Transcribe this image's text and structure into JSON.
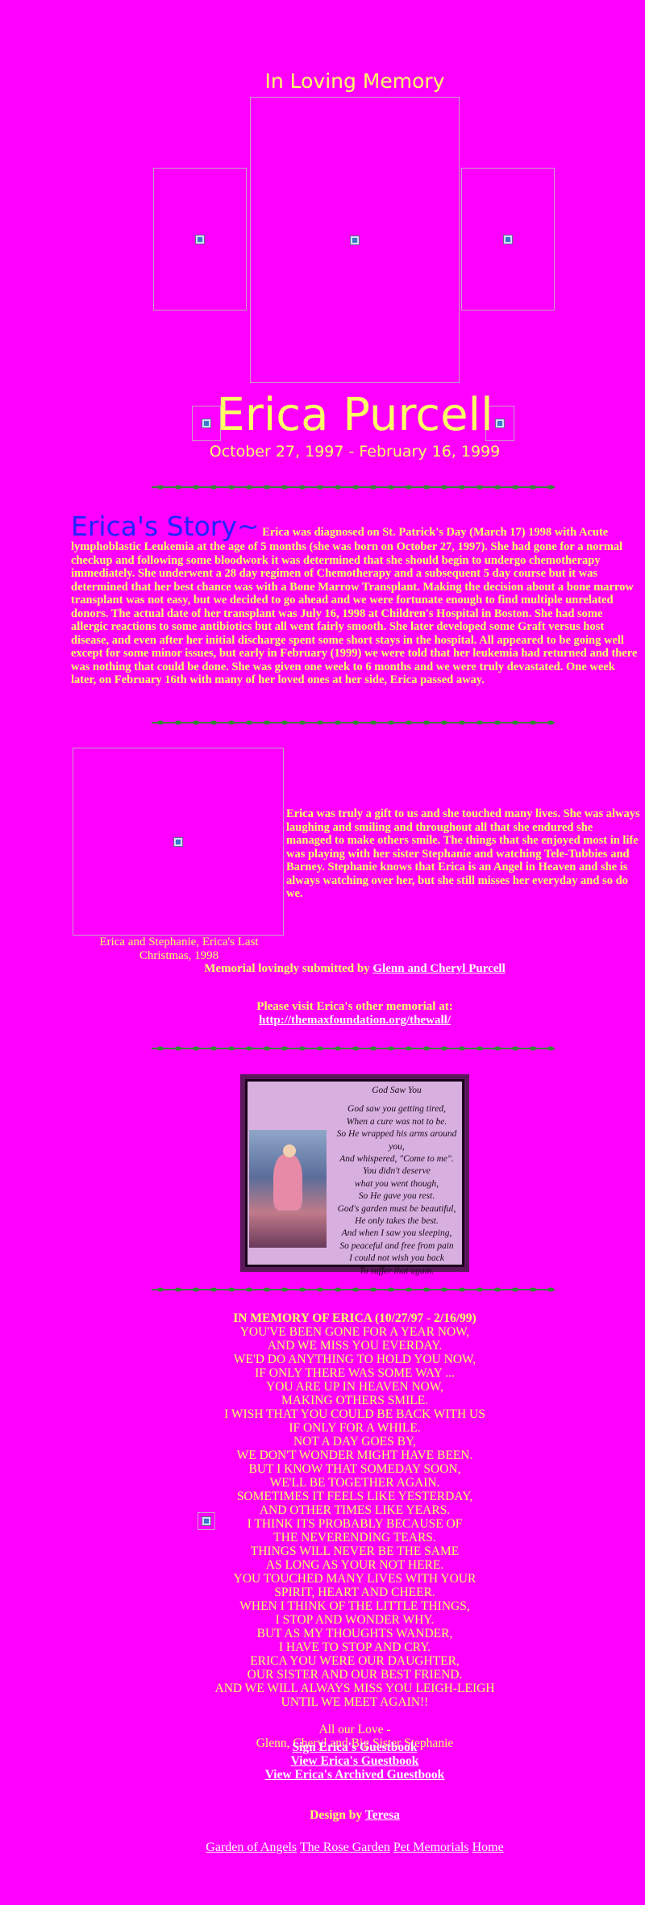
{
  "header": {
    "title": "In Loving Memory",
    "name": "Erica Purcell",
    "dates": "October 27, 1997 - February 16, 1999"
  },
  "story": {
    "heading": "Erica's Story~",
    "text": "Erica was diagnosed on St. Patrick's Day (March 17) 1998 with Acute lymphoblastic Leukemia at the age of 5 months (she was born on October 27, 1997). She had gone for a normal checkup and following some bloodwork it was determined that she should begin to undergo chemotherapy immediately. She underwent a 28 day regimen of Chemotherapy and a subsequent 5 day course but it was determined that her best chance was with a Bone Marrow Transplant. Making the decision about a bone marrow transplant was not easy, but we decided to go ahead and we were fortunate enough to find multiple unrelated donors. The actual date of her transplant was July 16, 1998 at Children's Hospital in Boston. She had some allergic reactions to some antibiotics but all went fairly smooth. She later developed some Graft versus host disease, and even after her initial discharge spent some short stays in the hospital. All appeared to be going well except for some minor issues, but early in February (1999) we were told that her leukemia had returned and there was nothing that could be done. She was given one week to 6 months and we were truly devastated. One week later, on February 16th with many of her loved ones at her side, Erica passed away."
  },
  "gift": {
    "text": "Erica was truly a gift to us and she touched many lives. She was always laughing and smiling and throughout all that she endured she managed to make others smile. The things that she enjoyed most in life was playing with her sister Stephanie and watching Tele-Tubbies and Barney. Stephanie knows that Erica is an Angel in Heaven and she is always watching over her, but she still misses her everyday and so do we.",
    "caption": "Erica and Stephanie, Erica's Last Christmas, 1998"
  },
  "submitted": {
    "prefix": "Memorial lovingly submitted by",
    "link": "Glenn and Cheryl Purcell "
  },
  "other": {
    "prefix": "Please visit Erica's other memorial at:",
    "link": "http://themaxfoundation.org/thewall/"
  },
  "poem": {
    "title": "God Saw You",
    "lines": [
      "God saw you getting tired,",
      "When a cure was not to be.",
      "So He wrapped his arms around you,",
      "And whispered, \"Come to me\".",
      "You didn't deserve",
      "what you went though,",
      "So He gave you rest.",
      "God's garden must be beautiful,",
      "He only takes the best.",
      "And when I saw you sleeping,",
      "So peaceful and free from pain",
      "I could not wish you back",
      "To suffer that again."
    ]
  },
  "tribute": {
    "heading": "IN MEMORY OF ERICA (10/27/97 - 2/16/99)",
    "lines": [
      "YOU'VE BEEN GONE FOR A YEAR NOW,",
      "AND WE MISS YOU EVERDAY.",
      "WE'D DO ANYTHING TO HOLD YOU NOW,",
      "IF ONLY THERE WAS SOME WAY ...",
      "YOU ARE UP IN HEAVEN NOW,",
      "MAKING OTHERS SMILE.",
      "I WISH THAT YOU COULD BE BACK WITH US",
      "IF ONLY FOR A WHILE.",
      "NOT A DAY GOES BY,",
      "WE DON'T WONDER MIGHT HAVE BEEN.",
      "BUT I KNOW THAT SOMEDAY SOON,",
      "WE'LL BE TOGETHER AGAIN.",
      "SOMETIMES IT FEELS LIKE YESTERDAY,",
      "AND OTHER TIMES LIKE YEARS.",
      "I THINK ITS PROBABLY BECAUSE OF",
      "THE NEVERENDING TEARS.",
      "THINGS WILL NEVER BE THE SAME",
      "AS LONG AS YOUR NOT HERE.",
      "YOU TOUCHED MANY LIVES WITH YOUR",
      "SPIRIT, HEART AND CHEER.",
      "WHEN I THINK OF THE LITTLE THINGS,",
      "I STOP AND WONDER WHY.",
      "BUT AS MY THOUGHTS WANDER,",
      "I HAVE TO STOP AND CRY.",
      "ERICA YOU WERE OUR DAUGHTER,",
      "OUR SISTER AND OUR BEST FRIEND.",
      "AND WE WILL ALWAYS MISS YOU LEIGH-LEIGH",
      "UNTIL WE MEET AGAIN!!"
    ],
    "signoff1": "All our Love -",
    "signoff2": "Glenn, Cheryl and Big Sister Stephanie"
  },
  "guestbook": {
    "sign": "Sign Erica's Guestbook",
    "view": "View Erica's Guestbook",
    "archived": "View Erica's Archived Guestbook"
  },
  "design": {
    "prefix": "Design by",
    "link": "Teresa"
  },
  "footer": {
    "links": [
      "Garden of Angels",
      "The Rose Garden",
      "Pet Memorials",
      "Home"
    ]
  },
  "colors": {
    "background": "#ff00ff",
    "text": "#ffff66",
    "heading": "#2222ff",
    "link": "#ffffff"
  }
}
